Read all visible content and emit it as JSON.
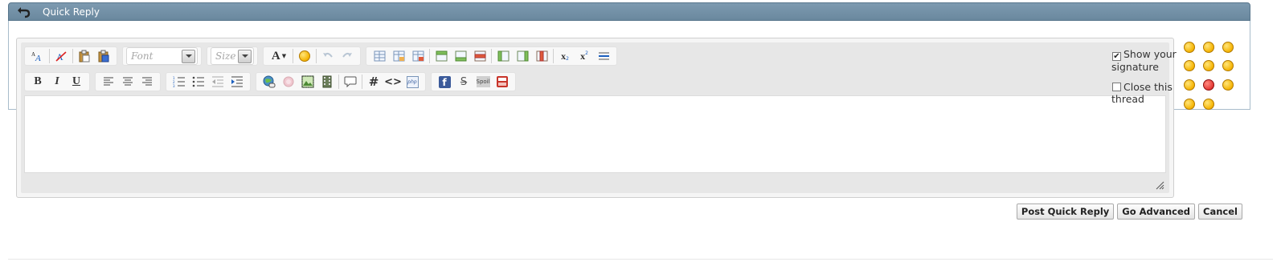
{
  "header": {
    "title": "Quick Reply"
  },
  "toolbar": {
    "font_placeholder": "Font",
    "size_placeholder": "Size",
    "bold": "B",
    "italic": "I",
    "underline": "U",
    "hash": "#",
    "code": "<>",
    "php": "php",
    "spoiler": "Spoil",
    "font_color": "A",
    "subscript": "x",
    "superscript": "x"
  },
  "options": {
    "show_signature": {
      "label": "Show your signature",
      "checked": true
    },
    "close_thread": {
      "label": "Close this thread",
      "checked": false
    }
  },
  "message": {
    "value": ""
  },
  "actions": {
    "post": "Post Quick Reply",
    "advanced": "Go Advanced",
    "cancel": "Cancel"
  },
  "colors": {
    "header_bg": "#6a889e",
    "panel_border": "#a8bccb",
    "smiley": "#f5b300"
  }
}
